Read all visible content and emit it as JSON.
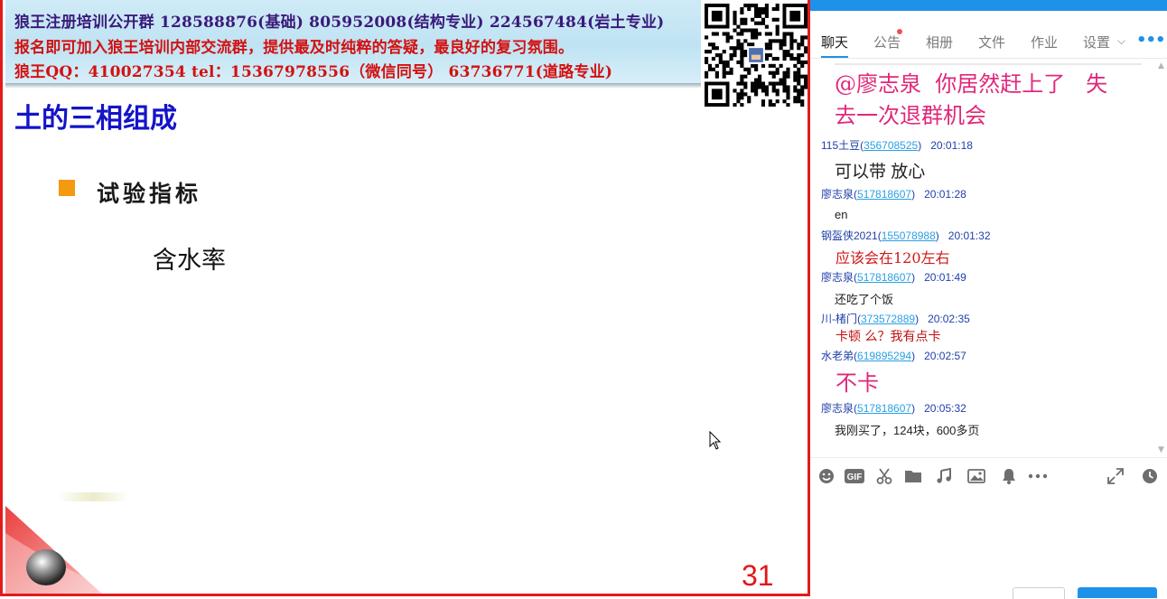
{
  "slide": {
    "banner": {
      "line1": "狼王注册培训公开群 128588876(基础)   805952008(结构专业) 224567484(岩土专业)",
      "line2": "报名即可加入狼王培训内部交流群，提供最及时纯粹的答疑，最良好的复习氛围。",
      "line3": "狼王QQ：410027354      tel：15367978556（微信同号）     63736771(道路专业)"
    },
    "title": "土的三相组成",
    "bullet": "试验指标",
    "sub_item": "含水率",
    "page_number": "31",
    "colors": {
      "title": "#1414c8",
      "bullet": "#f39a10",
      "border": "#e31b1b",
      "page_number": "#e01818"
    }
  },
  "panel": {
    "tabs": [
      {
        "label": "聊天"
      },
      {
        "label": "公告"
      },
      {
        "label": "相册"
      },
      {
        "label": "文件"
      },
      {
        "label": "作业"
      },
      {
        "label": "设置"
      }
    ],
    "settings_chevron": "⌵",
    "more_icon": "•••",
    "messages": [
      {
        "content": "@廖志泉  你居然赶上了   失\n去一次退群机会",
        "color": "#e0287a"
      },
      {
        "sender": "115土豆",
        "qq": "356708525",
        "time": "20:01:18",
        "content": "可以带 放心",
        "color": "#222222"
      },
      {
        "sender": "廖志泉",
        "qq": "517818607",
        "time": "20:01:28",
        "content": "en",
        "color": "#222222"
      },
      {
        "sender": "钢盔侠2021",
        "qq": "155078988",
        "time": "20:01:32",
        "content": "应该会在120左右",
        "color": "#d01818"
      },
      {
        "sender": "廖志泉",
        "qq": "517818607",
        "time": "20:01:49",
        "content": "还吃了个饭",
        "color": "#222222"
      },
      {
        "sender": "川-楮门",
        "qq": "373572889",
        "time": "20:02:35",
        "content": "卡顿  么？我有点卡",
        "color": "#c01010"
      },
      {
        "sender": "水老弟",
        "qq": "619895294",
        "time": "20:02:57",
        "content": "不卡",
        "color": "#e0287a"
      },
      {
        "sender": "廖志泉",
        "qq": "517818607",
        "time": "20:05:32",
        "content": "我刚买了，124块，600多页",
        "color": "#222222"
      }
    ],
    "toolbar_icons": [
      "emoji-icon",
      "gif-icon",
      "scissors-icon",
      "folder-icon",
      "music-icon",
      "image-icon",
      "bell-icon",
      "more-icon",
      "expand-icon",
      "clock-icon"
    ],
    "toolbar_gif_label": "GIF",
    "accent": "#1e91e8"
  }
}
